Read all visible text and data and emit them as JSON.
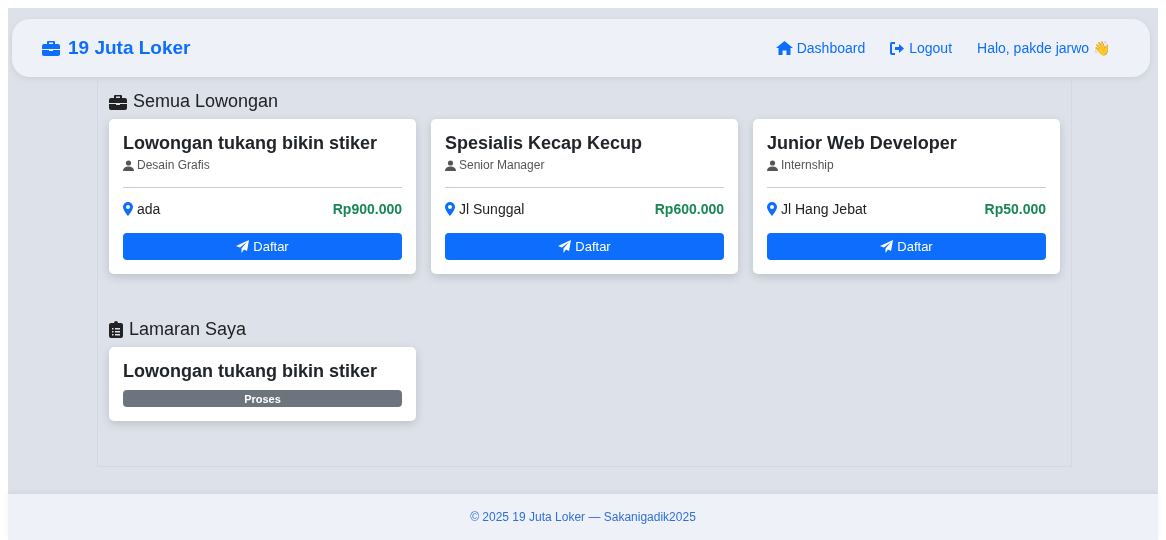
{
  "navbar": {
    "brand": "19 Juta Loker",
    "links": [
      {
        "kind": "home",
        "label": "Dashboard"
      },
      {
        "kind": "logout",
        "label": "Logout"
      }
    ],
    "greeting": "Halo, pakde jarwo 👋"
  },
  "jobs": {
    "title": "Semua Lowongan",
    "cards": [
      {
        "title": "Lowongan tukang bikin stiker",
        "category": "Desain Grafis",
        "location": "ada",
        "salary": "Rp900.000",
        "button": "Daftar"
      },
      {
        "title": "Spesialis Kecap Kecup",
        "category": "Senior Manager",
        "location": "Jl Sunggal",
        "salary": "Rp600.000",
        "button": "Daftar"
      },
      {
        "title": "Junior Web Developer",
        "category": "Internship",
        "location": "Jl Hang Jebat",
        "salary": "Rp50.000",
        "button": "Daftar"
      }
    ]
  },
  "applications": {
    "title": "Lamaran Saya",
    "cards": [
      {
        "title": "Lowongan tukang bikin stiker",
        "status": {
          "kind": "pending",
          "label": "Proses"
        }
      }
    ]
  },
  "footer": "© 2025 19 Juta Loker — Sakanigadik2025"
}
